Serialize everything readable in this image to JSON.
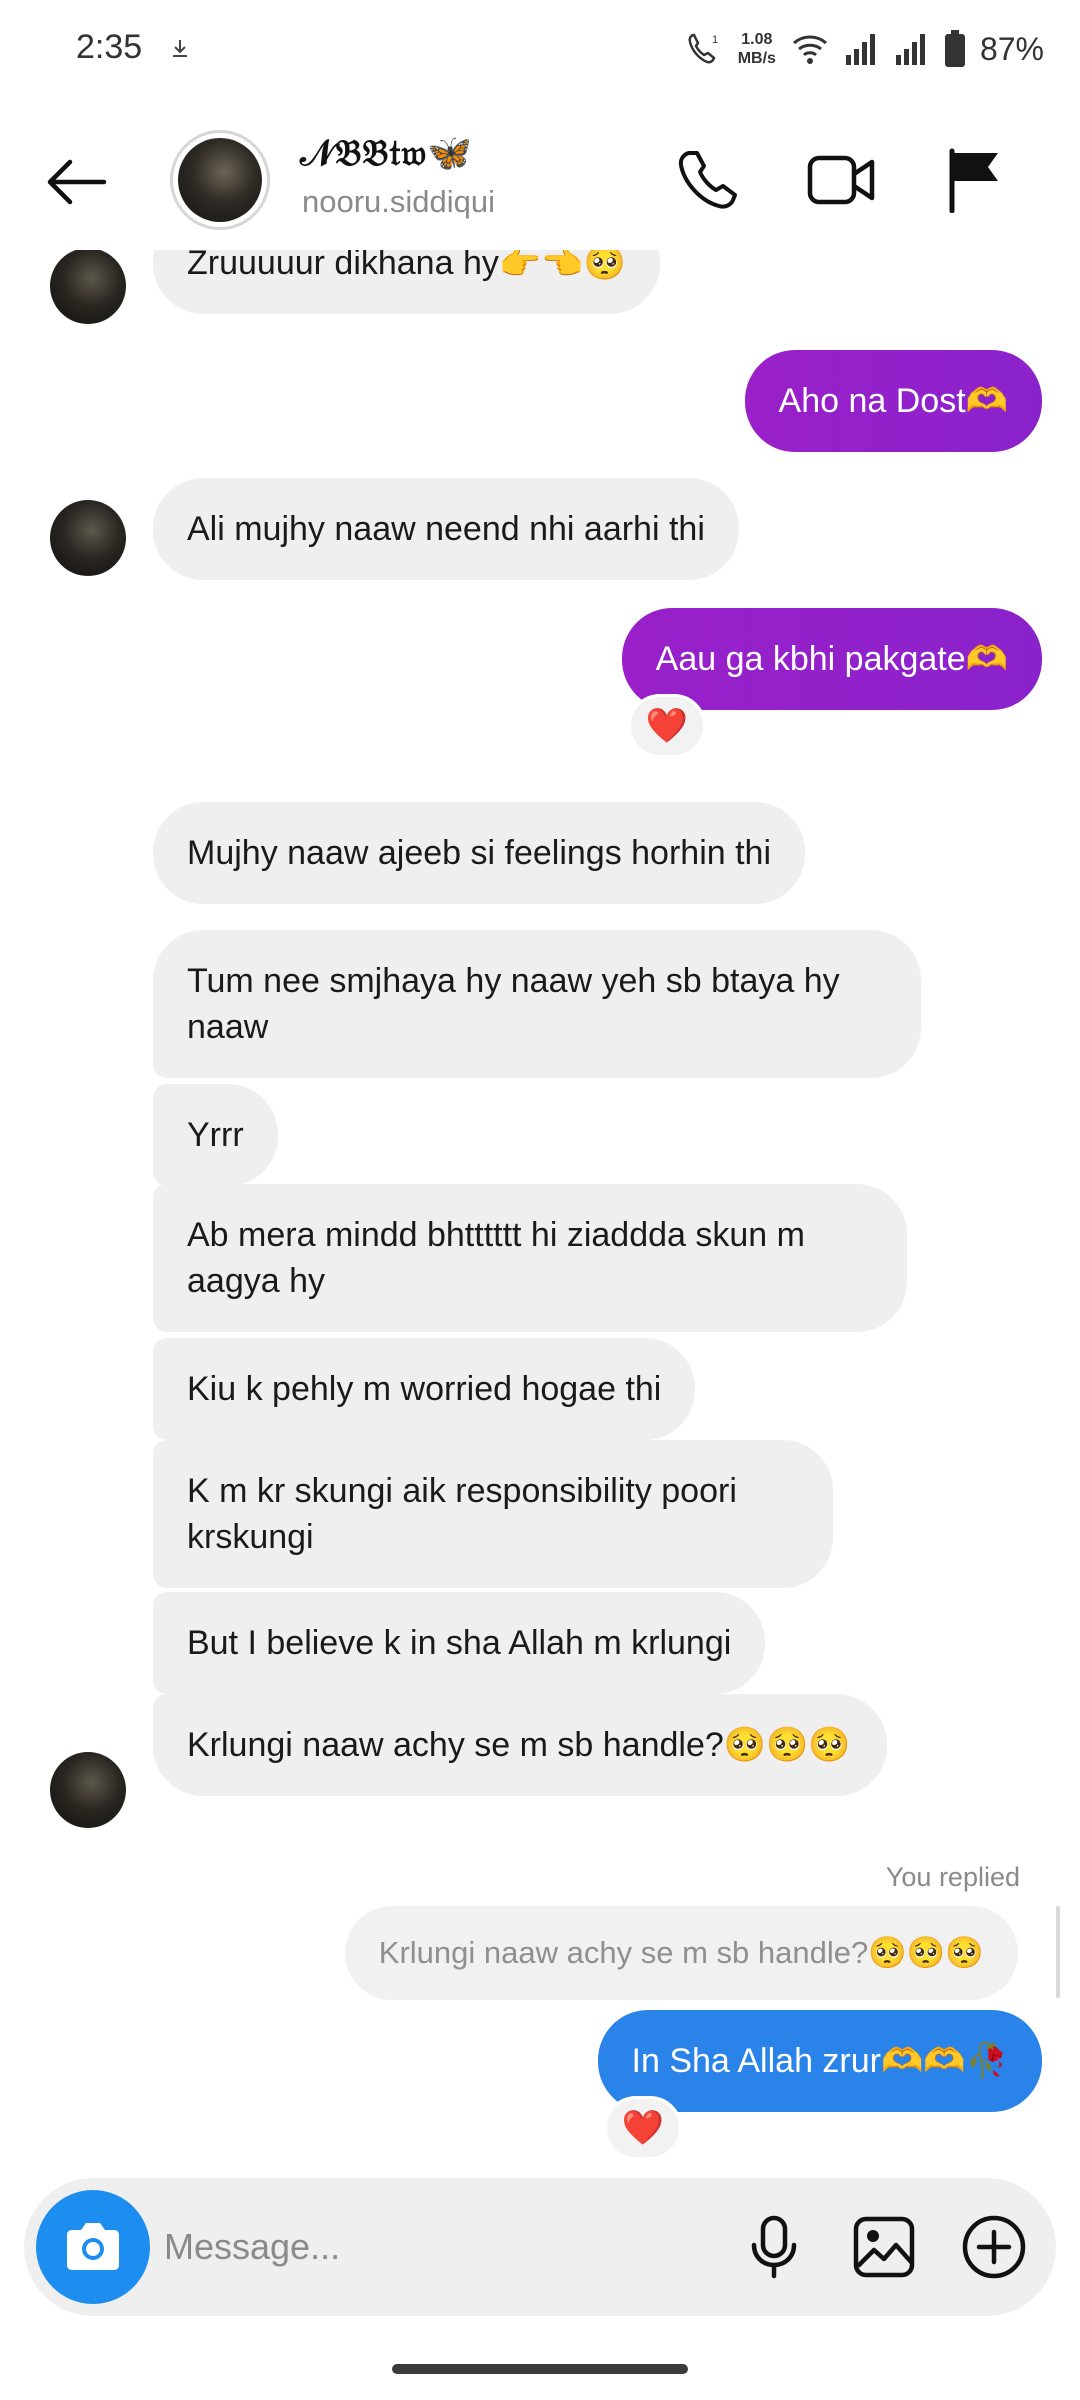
{
  "status_bar": {
    "time": "2:35",
    "net_speed_value": "1.08",
    "net_speed_unit": "MB/s",
    "battery": "87%"
  },
  "header": {
    "display_name": "𝒩𝔅𝔅𝔱𝔴🦋",
    "username": "nooru.siddiqui"
  },
  "messages": [
    {
      "text": "Zruuuuur dikhana hy👉👈🥺",
      "sender": "them"
    },
    {
      "text": "Aho na Dost🫶",
      "sender": "me"
    },
    {
      "text": "Ali mujhy naaw neend nhi aarhi thi",
      "sender": "them"
    },
    {
      "text": "Aau ga kbhi pakgate🫶",
      "sender": "me",
      "reaction": "❤️"
    },
    {
      "text": "Mujhy naaw ajeeb si feelings horhin thi",
      "sender": "them"
    },
    {
      "text": "Tum nee smjhaya hy naaw yeh sb btaya hy naaw",
      "sender": "them"
    },
    {
      "text": "Yrrr",
      "sender": "them"
    },
    {
      "text": "Ab mera mindd bhtttttt hi ziaddda skun m aagya hy",
      "sender": "them"
    },
    {
      "text": "Kiu k pehly m worried hogae thi",
      "sender": "them"
    },
    {
      "text": "K m kr skungi aik responsibility poori krskungi",
      "sender": "them"
    },
    {
      "text": "But I believe k in sha Allah m krlungi",
      "sender": "them"
    },
    {
      "text": "Krlungi naaw achy se m sb handle?🥺🥺🥺",
      "sender": "them"
    },
    {
      "text": "In Sha Allah zrur🫶🫶🥀",
      "sender": "me",
      "reaction": "❤️"
    }
  ],
  "reply": {
    "label": "You replied",
    "quoted_text": "Krlungi naaw achy se m sb handle?🥺🥺🥺"
  },
  "composer": {
    "placeholder": "Message..."
  },
  "colors": {
    "outgoing_purple": "#8a22cc",
    "outgoing_blue": "#2a83e8",
    "incoming_bg": "#efefef",
    "camera_button": "#1d8ef0"
  },
  "icons": [
    "back-arrow-icon",
    "phone-icon",
    "video-camera-icon",
    "flag-icon",
    "camera-icon",
    "microphone-icon",
    "image-icon",
    "plus-circle-icon",
    "heart-icon"
  ]
}
